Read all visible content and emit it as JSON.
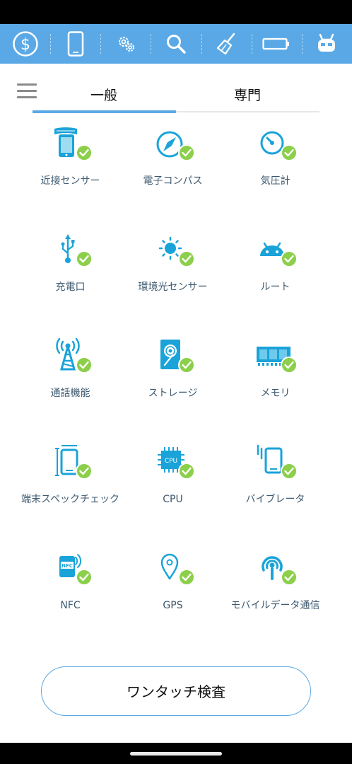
{
  "toolbar": {
    "items": [
      {
        "icon": "dollar-icon"
      },
      {
        "icon": "phone-icon"
      },
      {
        "icon": "gear-icon"
      },
      {
        "icon": "search-icon"
      },
      {
        "icon": "broom-icon"
      },
      {
        "icon": "battery-icon"
      },
      {
        "icon": "robot-icon"
      }
    ],
    "color": "#5aa9e6"
  },
  "tabs": [
    {
      "label": "一般",
      "active": true
    },
    {
      "label": "専門",
      "active": false
    }
  ],
  "items": [
    {
      "label": "近接センサー",
      "icon": "proximity-sensor-icon"
    },
    {
      "label": "電子コンパス",
      "icon": "compass-icon"
    },
    {
      "label": "気圧計",
      "icon": "barometer-icon"
    },
    {
      "label": "充電口",
      "icon": "usb-icon"
    },
    {
      "label": "環境光センサー",
      "icon": "light-sensor-icon"
    },
    {
      "label": "ルート",
      "icon": "android-icon"
    },
    {
      "label": "通話機能",
      "icon": "antenna-icon"
    },
    {
      "label": "ストレージ",
      "icon": "storage-icon"
    },
    {
      "label": "メモリ",
      "icon": "memory-icon"
    },
    {
      "label": "端末スペックチェック",
      "icon": "device-spec-icon"
    },
    {
      "label": "CPU",
      "icon": "cpu-icon",
      "chip_text": "CPU"
    },
    {
      "label": "バイブレータ",
      "icon": "vibrator-icon"
    },
    {
      "label": "NFC",
      "icon": "nfc-icon",
      "chip_text": "NFC"
    },
    {
      "label": "GPS",
      "icon": "gps-icon"
    },
    {
      "label": "モバイルデータ通信",
      "icon": "mobile-data-icon"
    }
  ],
  "colors": {
    "icon": "#1aa3d9",
    "check": "#8ccf4b",
    "label": "#3e5a70"
  },
  "button": {
    "label": "ワンタッチ検査"
  }
}
